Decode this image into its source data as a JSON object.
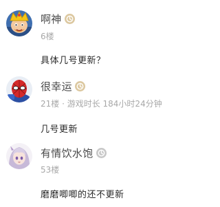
{
  "comments": [
    {
      "username": "啊神",
      "floor": "6楼",
      "text": "具体几号更新？",
      "avatar_icon": "clash-king-avatar",
      "badge_color": "#dcc8a0"
    },
    {
      "username": "很幸运",
      "floor": "21楼 · 游戏时长 184小时24分钟",
      "text": "几号更新",
      "avatar_icon": "spiderman-avatar",
      "badge_color": "#dcc8a0"
    },
    {
      "username": "有情饮水饱",
      "floor": "53楼",
      "text": "磨磨唧唧的还不更新",
      "avatar_icon": "anime-girl-avatar",
      "badge_color": "#c8c8c8"
    }
  ]
}
